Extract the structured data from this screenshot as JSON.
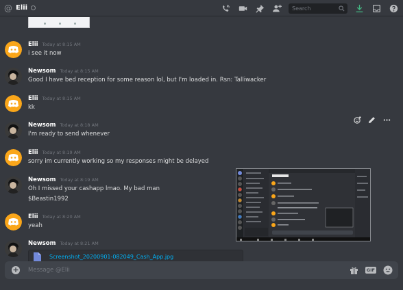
{
  "header": {
    "at_symbol": "@",
    "dm_name": "Elii",
    "search_placeholder": "Search",
    "icons": [
      "call-icon",
      "video-icon",
      "pin-icon",
      "add-member-icon",
      "search-icon",
      "download-icon",
      "inbox-icon",
      "help-icon"
    ]
  },
  "messages": [
    {
      "author": "Elii",
      "timestamp": "Today at 8:15 AM",
      "lines": [
        "i see it now"
      ],
      "avatar": "discord-yellow"
    },
    {
      "author": "Newsom",
      "timestamp": "Today at 8:15 AM",
      "lines": [
        "Good I have bed reception for some reason lol, but I'm loaded in. Rsn: Talliwacker"
      ],
      "avatar": "photo"
    },
    {
      "author": "Elii",
      "timestamp": "Today at 8:15 AM",
      "lines": [
        "kk"
      ],
      "avatar": "discord-yellow"
    },
    {
      "author": "Newsom",
      "timestamp": "Today at 8:18 AM",
      "lines": [
        "I'm ready to send whenever"
      ],
      "avatar": "photo"
    },
    {
      "author": "Elii",
      "timestamp": "Today at 8:19 AM",
      "lines": [
        "sorry im currently working so my responses might be delayed"
      ],
      "avatar": "discord-yellow"
    },
    {
      "author": "Newsom",
      "timestamp": "Today at 8:19 AM",
      "lines": [
        "Oh I missed your cashapp lmao. My bad man",
        "$Beastin1992"
      ],
      "avatar": "photo"
    },
    {
      "author": "Elii",
      "timestamp": "Today at 8:20 AM",
      "lines": [
        "yeah"
      ],
      "avatar": "discord-yellow"
    },
    {
      "author": "Newsom",
      "timestamp": "Today at 8:21 AM",
      "lines": [],
      "avatar": "photo"
    }
  ],
  "attachment": {
    "filename": "Screenshot_20200901-082049_Cash_App.jpg"
  },
  "hover_tools": [
    "add-reaction-icon",
    "edit-icon",
    "more-icon"
  ],
  "composer": {
    "placeholder": "Message @Elii",
    "icons": [
      "gift-icon",
      "gif-icon",
      "emoji-icon"
    ],
    "gif_label": "GIF"
  },
  "colors": {
    "background": "#36393f",
    "accent_yellow": "#faa61a",
    "link": "#00b0f4"
  }
}
